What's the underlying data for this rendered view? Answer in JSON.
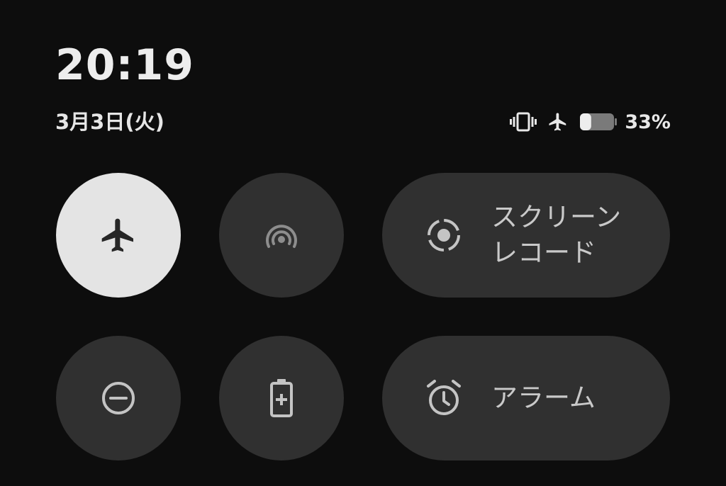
{
  "header": {
    "time": "20:19",
    "date": "3月3日(火)"
  },
  "status": {
    "icons": [
      "vibrate-icon",
      "airplane-icon",
      "battery-icon"
    ],
    "battery_percent": "33%",
    "battery_level": 0.33
  },
  "tiles": [
    {
      "id": "airplane",
      "icon": "airplane-icon",
      "active": true,
      "label": ""
    },
    {
      "id": "hotspot",
      "icon": "hotspot-icon",
      "active": false,
      "label": ""
    },
    {
      "id": "screen-record",
      "icon": "screen-record-icon",
      "active": false,
      "label": "スクリーン\nレコード"
    },
    {
      "id": "do-not-disturb",
      "icon": "do-not-disturb-icon",
      "active": false,
      "label": ""
    },
    {
      "id": "battery-saver",
      "icon": "battery-saver-icon",
      "active": false,
      "label": ""
    },
    {
      "id": "alarm",
      "icon": "alarm-icon",
      "active": false,
      "label": "アラーム"
    }
  ],
  "colors": {
    "background": "#0d0d0d",
    "tile_inactive": "#303030",
    "tile_active": "#e4e4e4",
    "icon_inactive": "#bdbdbd",
    "icon_active": "#262626"
  }
}
